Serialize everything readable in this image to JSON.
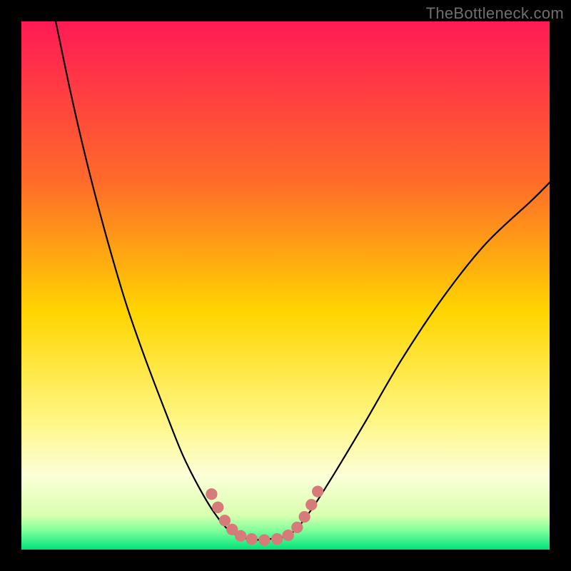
{
  "watermark": "TheBottleneck.com",
  "chart_data": {
    "type": "line",
    "title": "",
    "xlabel": "",
    "ylabel": "",
    "xlim": [
      0,
      1
    ],
    "ylim": [
      0,
      1
    ],
    "background_gradient": {
      "type": "vertical",
      "stops": [
        {
          "offset": 0.0,
          "color": "#ff1a55"
        },
        {
          "offset": 0.3,
          "color": "#ff6a2a"
        },
        {
          "offset": 0.55,
          "color": "#ffd500"
        },
        {
          "offset": 0.75,
          "color": "#fff680"
        },
        {
          "offset": 0.86,
          "color": "#fcffd8"
        },
        {
          "offset": 0.935,
          "color": "#d9ffb0"
        },
        {
          "offset": 0.965,
          "color": "#7cff9a"
        },
        {
          "offset": 1.0,
          "color": "#00e27a"
        }
      ]
    },
    "series": [
      {
        "name": "left-limb",
        "stroke": "#000000",
        "x": [
          0.065,
          0.09,
          0.115,
          0.14,
          0.17,
          0.2,
          0.235,
          0.275,
          0.305,
          0.335,
          0.365,
          0.395
        ],
        "y": [
          1.0,
          0.88,
          0.77,
          0.67,
          0.56,
          0.46,
          0.36,
          0.255,
          0.18,
          0.12,
          0.07,
          0.035
        ]
      },
      {
        "name": "valley-floor",
        "stroke": "#000000",
        "x": [
          0.395,
          0.43,
          0.47,
          0.51
        ],
        "y": [
          0.035,
          0.02,
          0.02,
          0.03
        ]
      },
      {
        "name": "right-limb",
        "stroke": "#000000",
        "x": [
          0.51,
          0.545,
          0.59,
          0.65,
          0.72,
          0.8,
          0.88,
          0.965,
          1.0
        ],
        "y": [
          0.03,
          0.07,
          0.14,
          0.24,
          0.36,
          0.48,
          0.58,
          0.66,
          0.695
        ]
      }
    ],
    "marks": {
      "name": "valley-dots",
      "color": "#d77a7a",
      "radius": 0.011,
      "points": [
        {
          "x": 0.36,
          "y": 0.105
        },
        {
          "x": 0.372,
          "y": 0.08
        },
        {
          "x": 0.385,
          "y": 0.055
        },
        {
          "x": 0.399,
          "y": 0.038
        },
        {
          "x": 0.415,
          "y": 0.026
        },
        {
          "x": 0.436,
          "y": 0.02
        },
        {
          "x": 0.46,
          "y": 0.018
        },
        {
          "x": 0.484,
          "y": 0.02
        },
        {
          "x": 0.505,
          "y": 0.027
        },
        {
          "x": 0.522,
          "y": 0.042
        },
        {
          "x": 0.536,
          "y": 0.062
        },
        {
          "x": 0.549,
          "y": 0.085
        },
        {
          "x": 0.561,
          "y": 0.11
        }
      ]
    }
  }
}
